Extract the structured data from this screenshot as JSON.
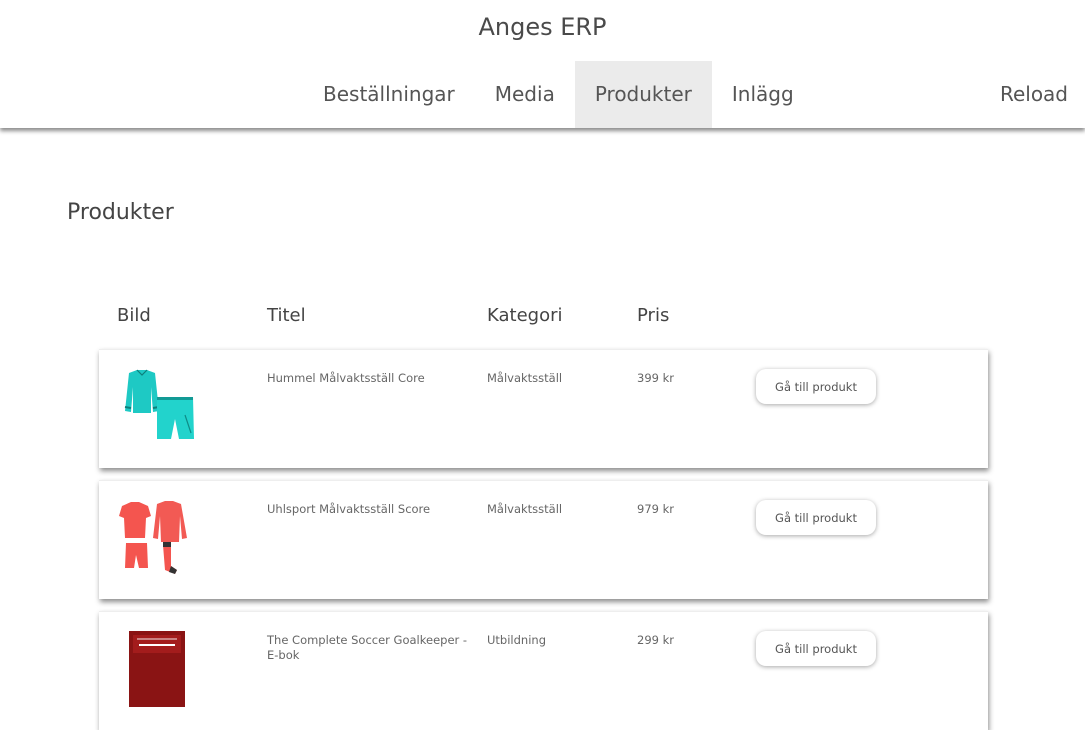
{
  "app": {
    "title": "Anges ERP"
  },
  "nav": {
    "items": [
      {
        "label": "Beställningar",
        "active": false
      },
      {
        "label": "Media",
        "active": false
      },
      {
        "label": "Produkter",
        "active": true
      },
      {
        "label": "Inlägg",
        "active": false
      }
    ],
    "reload_label": "Reload"
  },
  "page": {
    "title": "Produkter"
  },
  "table": {
    "headers": [
      "Bild",
      "Titel",
      "Kategori",
      "Pris"
    ],
    "button_label": "Gå till produkt",
    "rows": [
      {
        "image": "cyan-goalkeeper-kit",
        "title": "Hummel Målvaktsställ Core",
        "category": "Målvaktsställ",
        "price": "399 kr"
      },
      {
        "image": "coral-goalkeeper-kit",
        "title": "Uhlsport Målvaktsställ Score",
        "category": "Målvaktsställ",
        "price": "979 kr"
      },
      {
        "image": "book-cover",
        "title": "The Complete Soccer Goalkeeper - E-bok",
        "category": "Utbildning",
        "price": "299 kr"
      }
    ]
  },
  "colors": {
    "active_nav_bg": "#ebebeb",
    "cyan_kit": "#1ec9c4",
    "coral_kit": "#f4554f",
    "book": "#8a1414"
  }
}
